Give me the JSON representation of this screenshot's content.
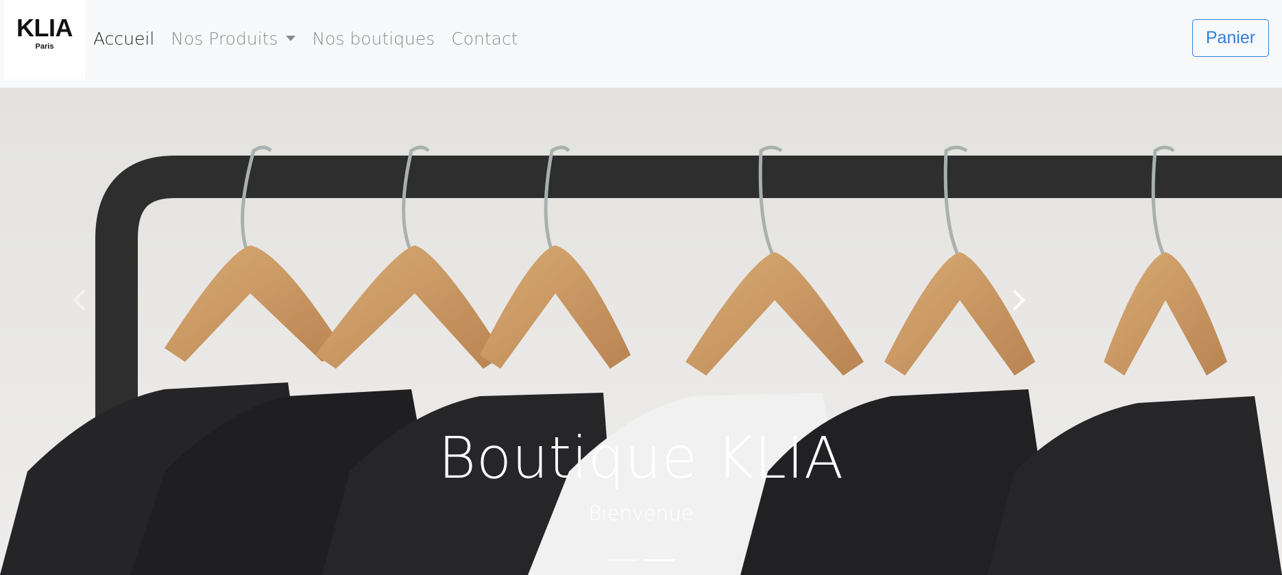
{
  "brand": {
    "name": "KLIA",
    "sub": "Paris"
  },
  "nav": {
    "items": [
      {
        "label": "Accueil"
      },
      {
        "label": "Nos Produits"
      },
      {
        "label": "Nos boutiques"
      },
      {
        "label": "Contact"
      }
    ],
    "active_item": "Accueil",
    "cart_label": "Panier"
  },
  "hero": {
    "title": "Boutique KLIA",
    "subtitle": "Bienvenue",
    "slide_count": 2,
    "active_slide": 2
  },
  "colors": {
    "navbar_bg": "#f8f9fa",
    "accent": "#2f7de1",
    "hero_bg": "#e7e6e4"
  },
  "icons": {
    "dropdown": "caret-down-icon",
    "prev": "chevron-left-icon",
    "next": "chevron-right-icon"
  }
}
